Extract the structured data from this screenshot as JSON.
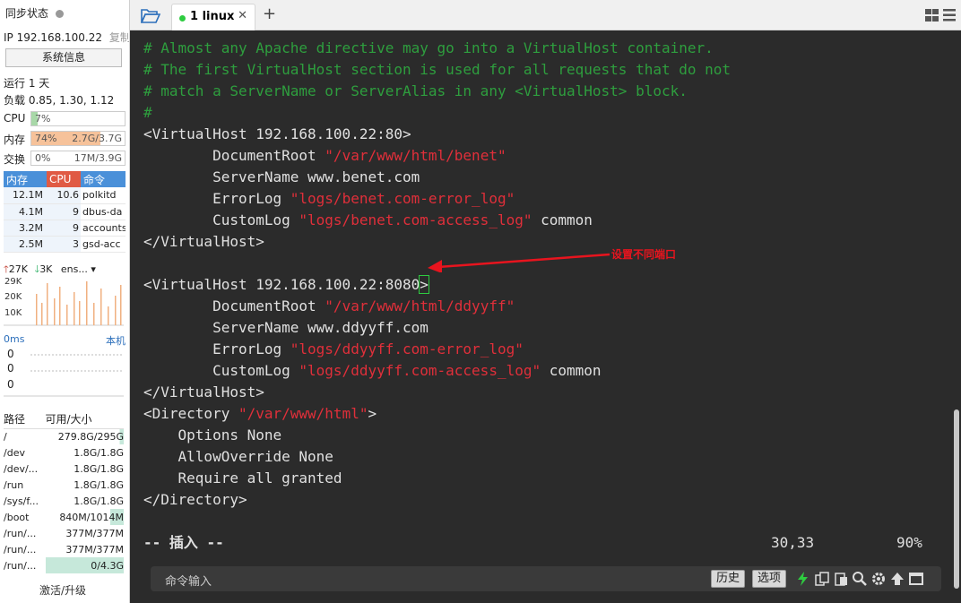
{
  "sidebar": {
    "sync_status": "同步状态",
    "ip_label": "IP 192.168.100.22",
    "copy": "复制",
    "sysinfo_btn": "系统信息",
    "uptime": "运行 1 天",
    "load": "负载 0.85, 1.30, 1.12",
    "cpu": {
      "label": "CPU",
      "pct": "7%",
      "value": 0.07
    },
    "mem": {
      "label": "内存",
      "pct": "74%",
      "amount": "2.7G/3.7G",
      "value": 0.74
    },
    "swap": {
      "label": "交换",
      "pct": "0%",
      "amount": "17M/3.9G",
      "value": 0.0
    },
    "proc_headers": [
      "内存",
      "CPU",
      "命令"
    ],
    "processes": [
      {
        "mem": "12.1M",
        "cpu": "10.6",
        "cmd": "polkitd"
      },
      {
        "mem": "4.1M",
        "cpu": "9",
        "cmd": "dbus-da"
      },
      {
        "mem": "3.2M",
        "cpu": "9",
        "cmd": "accounts"
      },
      {
        "mem": "2.5M",
        "cpu": "3",
        "cmd": "gsd-acc"
      }
    ],
    "net": {
      "up": "27K",
      "down": "3K",
      "iface": "ens..."
    },
    "net_axis": [
      "29K",
      "20K",
      "10K"
    ],
    "latency": {
      "label": "0ms",
      "host": "本机",
      "values": [
        "0",
        "0",
        "0"
      ]
    },
    "disk_headers": [
      "路径",
      "可用/大小"
    ],
    "disks": [
      {
        "path": "/",
        "size": "279.8G/295G",
        "used": 0.05
      },
      {
        "path": "/dev",
        "size": "1.8G/1.8G",
        "used": 0.0
      },
      {
        "path": "/dev/...",
        "size": "1.8G/1.8G",
        "used": 0.0
      },
      {
        "path": "/run",
        "size": "1.8G/1.8G",
        "used": 0.0
      },
      {
        "path": "/sys/f...",
        "size": "1.8G/1.8G",
        "used": 0.0
      },
      {
        "path": "/boot",
        "size": "840M/1014M",
        "used": 0.17
      },
      {
        "path": "/run/...",
        "size": "377M/377M",
        "used": 0.0
      },
      {
        "path": "/run/...",
        "size": "377M/377M",
        "used": 0.0
      },
      {
        "path": "/run/...",
        "size": "0/4.3G",
        "used": 1.0
      }
    ],
    "activate": "激活/升级"
  },
  "tabs": {
    "active": "1 linux",
    "close": "✕",
    "add": "+"
  },
  "terminal": {
    "lines": [
      {
        "type": "comment",
        "text": "# Almost any Apache directive may go into a VirtualHost container."
      },
      {
        "type": "comment",
        "text": "# The first VirtualHost section is used for all requests that do not"
      },
      {
        "type": "comment",
        "text": "# match a ServerName or ServerAlias in any <VirtualHost> block."
      },
      {
        "type": "comment",
        "text": "#"
      },
      {
        "type": "plain",
        "text": "<VirtualHost 192.168.100.22:80>"
      },
      {
        "type": "kv",
        "key": "        DocumentRoot ",
        "str": "\"/var/www/html/benet\"",
        "rest": ""
      },
      {
        "type": "plain",
        "text": "        ServerName www.benet.com"
      },
      {
        "type": "kv",
        "key": "        ErrorLog ",
        "str": "\"logs/benet.com-error_log\"",
        "rest": ""
      },
      {
        "type": "kv",
        "key": "        CustomLog ",
        "str": "\"logs/benet.com-access_log\"",
        "rest": " common"
      },
      {
        "type": "plain",
        "text": "</VirtualHost>"
      },
      {
        "type": "plain",
        "text": ""
      },
      {
        "type": "cursor",
        "text": "<VirtualHost 192.168.100.22:8080",
        "cursor": ">"
      },
      {
        "type": "kv",
        "key": "        DocumentRoot ",
        "str": "\"/var/www/html/ddyyff\"",
        "rest": ""
      },
      {
        "type": "plain",
        "text": "        ServerName www.ddyyff.com"
      },
      {
        "type": "kv",
        "key": "        ErrorLog ",
        "str": "\"logs/ddyyff.com-error_log\"",
        "rest": ""
      },
      {
        "type": "kv",
        "key": "        CustomLog ",
        "str": "\"logs/ddyyff.com-access_log\"",
        "rest": " common"
      },
      {
        "type": "plain",
        "text": "</VirtualHost>"
      },
      {
        "type": "kv",
        "key": "<Directory ",
        "str": "\"/var/www/html\"",
        "rest": ">"
      },
      {
        "type": "plain",
        "text": "    Options None"
      },
      {
        "type": "plain",
        "text": "    AllowOverride None"
      },
      {
        "type": "plain",
        "text": "    Require all granted"
      },
      {
        "type": "plain",
        "text": "</Directory>"
      }
    ],
    "mode": "-- 插入 --",
    "position": "30,33",
    "percent": "90%",
    "annotation": "设置不同端口"
  },
  "cmdbar": {
    "placeholder": "命令输入",
    "history": "历史",
    "options": "选项"
  },
  "colors": {
    "comment": "#2e9e3e",
    "string": "#e02f3a",
    "proc_header_mem": "#4a90d9",
    "proc_header_cpu": "#e05a44",
    "mem_fill": "#f6c29a",
    "cpu_fill": "#a8d8a8"
  }
}
